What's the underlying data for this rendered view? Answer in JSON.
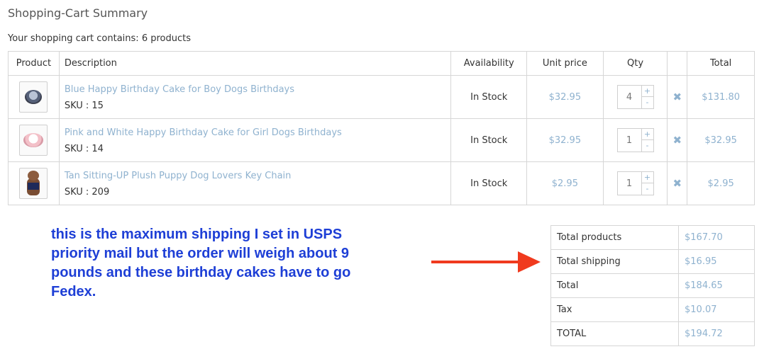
{
  "page": {
    "title": "Shopping-Cart Summary",
    "cart_count_text": "Your shopping cart contains: 6 products"
  },
  "table": {
    "headers": {
      "product": "Product",
      "description": "Description",
      "availability": "Availability",
      "unit_price": "Unit price",
      "qty": "Qty",
      "total": "Total"
    },
    "rows": [
      {
        "name": "Blue Happy Birthday Cake for Boy Dogs Birthdays",
        "sku": "SKU : 15",
        "availability": "In Stock",
        "unit_price": "$32.95",
        "qty": "4",
        "total": "$131.80",
        "thumb_icon": "blue-cake-thumbnail"
      },
      {
        "name": "Pink and White Happy Birthday Cake for Girl Dogs Birthdays",
        "sku": "SKU : 14",
        "availability": "In Stock",
        "unit_price": "$32.95",
        "qty": "1",
        "total": "$32.95",
        "thumb_icon": "pink-cake-thumbnail"
      },
      {
        "name": "Tan Sitting-UP Plush Puppy Dog Lovers Key Chain",
        "sku": "SKU : 209",
        "availability": "In Stock",
        "unit_price": "$2.95",
        "qty": "1",
        "total": "$2.95",
        "thumb_icon": "plush-puppy-thumbnail"
      }
    ],
    "qty_increment_symbol": "+",
    "qty_decrement_symbol": "-",
    "delete_symbol": "✖"
  },
  "annotation": {
    "note": "this is the maximum shipping I set in USPS priority mail but the order will weigh about 9 pounds and these birthday cakes have to go Fedex.",
    "color": "#1e3fd6",
    "arrow_color": "#f03a1e"
  },
  "totals": [
    {
      "label": "Total products",
      "value": "$167.70"
    },
    {
      "label": "Total shipping",
      "value": "$16.95"
    },
    {
      "label": "Total",
      "value": "$184.65"
    },
    {
      "label": "Tax",
      "value": "$10.07"
    },
    {
      "label": "TOTAL",
      "value": "$194.72"
    }
  ],
  "colors": {
    "link": "#8fb2cf",
    "border": "#d6d6d6"
  }
}
